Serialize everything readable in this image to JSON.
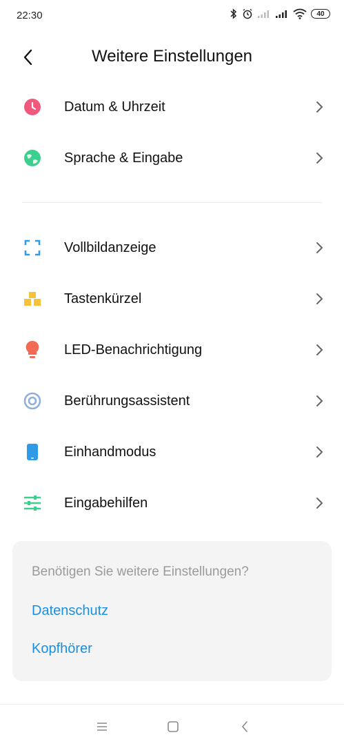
{
  "status_bar": {
    "time": "22:30",
    "battery": "40"
  },
  "header": {
    "title": "Weitere Einstellungen",
    "back_icon": "back-arrow-icon"
  },
  "group1": [
    {
      "label": "Datum & Uhrzeit",
      "icon": "clock-icon",
      "color": "#f0587c"
    },
    {
      "label": "Sprache & Eingabe",
      "icon": "globe-icon",
      "color": "#3ccf8e"
    }
  ],
  "group2": [
    {
      "label": "Vollbildanzeige",
      "icon": "fullscreen-icon",
      "color": "#2f9be8"
    },
    {
      "label": "Tastenkürzel",
      "icon": "shortcut-icon",
      "color": "#f5c23a"
    },
    {
      "label": "LED-Benachrichtigung",
      "icon": "bulb-icon",
      "color": "#f26a54"
    },
    {
      "label": "Berührungsassistent",
      "icon": "touch-assistant-icon",
      "color": "#8fb1d8"
    },
    {
      "label": "Einhandmodus",
      "icon": "phone-icon",
      "color": "#2f9be8"
    },
    {
      "label": "Eingabehilfen",
      "icon": "sliders-icon",
      "color": "#3ccf8e"
    }
  ],
  "card": {
    "title": "Benötigen Sie weitere Einstellungen?",
    "links": [
      "Datenschutz",
      "Kopfhörer"
    ]
  },
  "colors": {
    "link": "#1a8fe0",
    "card_bg": "#f4f4f4"
  }
}
